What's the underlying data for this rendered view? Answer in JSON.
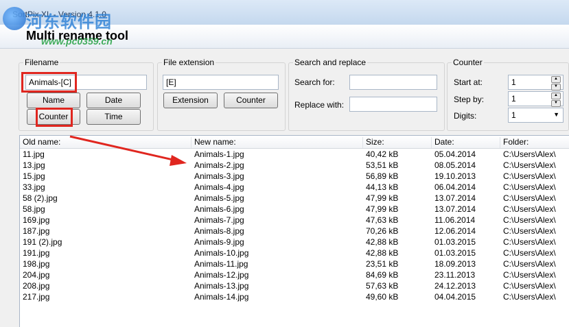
{
  "window": {
    "title": "SortPix XL - Version 4.1.0"
  },
  "watermark": {
    "site": "河东软件园",
    "url": "www.pc0359.cn"
  },
  "header": {
    "title": "Multi rename tool"
  },
  "filename": {
    "title": "Filename",
    "value": "Animals-[C]",
    "buttons": {
      "name": "Name",
      "date": "Date",
      "counter": "Counter",
      "time": "Time"
    }
  },
  "extension": {
    "title": "File extension",
    "value": "[E]",
    "buttons": {
      "extension": "Extension",
      "counter": "Counter"
    }
  },
  "search": {
    "title": "Search and replace",
    "search_label": "Search for:",
    "search_value": "",
    "replace_label": "Replace with:",
    "replace_value": ""
  },
  "counter": {
    "title": "Counter",
    "start_label": "Start at:",
    "start_value": "1",
    "step_label": "Step by:",
    "step_value": "1",
    "digits_label": "Digits:",
    "digits_value": "1"
  },
  "table": {
    "columns": [
      "Old name:",
      "New name:",
      "Size:",
      "Date:",
      "Folder:"
    ],
    "rows": [
      [
        "11.jpg",
        "Animals-1.jpg",
        "40,42 kB",
        "05.04.2014",
        "C:\\Users\\Alex\\"
      ],
      [
        "13.jpg",
        "Animals-2.jpg",
        "53,51 kB",
        "08.05.2014",
        "C:\\Users\\Alex\\"
      ],
      [
        "15.jpg",
        "Animals-3.jpg",
        "56,89 kB",
        "19.10.2013",
        "C:\\Users\\Alex\\"
      ],
      [
        "33.jpg",
        "Animals-4.jpg",
        "44,13 kB",
        "06.04.2014",
        "C:\\Users\\Alex\\"
      ],
      [
        "58 (2).jpg",
        "Animals-5.jpg",
        "47,99 kB",
        "13.07.2014",
        "C:\\Users\\Alex\\"
      ],
      [
        "58.jpg",
        "Animals-6.jpg",
        "47,99 kB",
        "13.07.2014",
        "C:\\Users\\Alex\\"
      ],
      [
        "169.jpg",
        "Animals-7.jpg",
        "47,63 kB",
        "11.06.2014",
        "C:\\Users\\Alex\\"
      ],
      [
        "187.jpg",
        "Animals-8.jpg",
        "70,26 kB",
        "12.06.2014",
        "C:\\Users\\Alex\\"
      ],
      [
        "191 (2).jpg",
        "Animals-9.jpg",
        "42,88 kB",
        "01.03.2015",
        "C:\\Users\\Alex\\"
      ],
      [
        "191.jpg",
        "Animals-10.jpg",
        "42,88 kB",
        "01.03.2015",
        "C:\\Users\\Alex\\"
      ],
      [
        "198.jpg",
        "Animals-11.jpg",
        "23,51 kB",
        "18.09.2013",
        "C:\\Users\\Alex\\"
      ],
      [
        "204.jpg",
        "Animals-12.jpg",
        "84,69 kB",
        "23.11.2013",
        "C:\\Users\\Alex\\"
      ],
      [
        "208.jpg",
        "Animals-13.jpg",
        "57,63 kB",
        "24.12.2013",
        "C:\\Users\\Alex\\"
      ],
      [
        "217.jpg",
        "Animals-14.jpg",
        "49,60 kB",
        "04.04.2015",
        "C:\\Users\\Alex\\"
      ]
    ]
  },
  "colors": {
    "highlight": "#e0261f",
    "arrow": "#e0261f"
  }
}
